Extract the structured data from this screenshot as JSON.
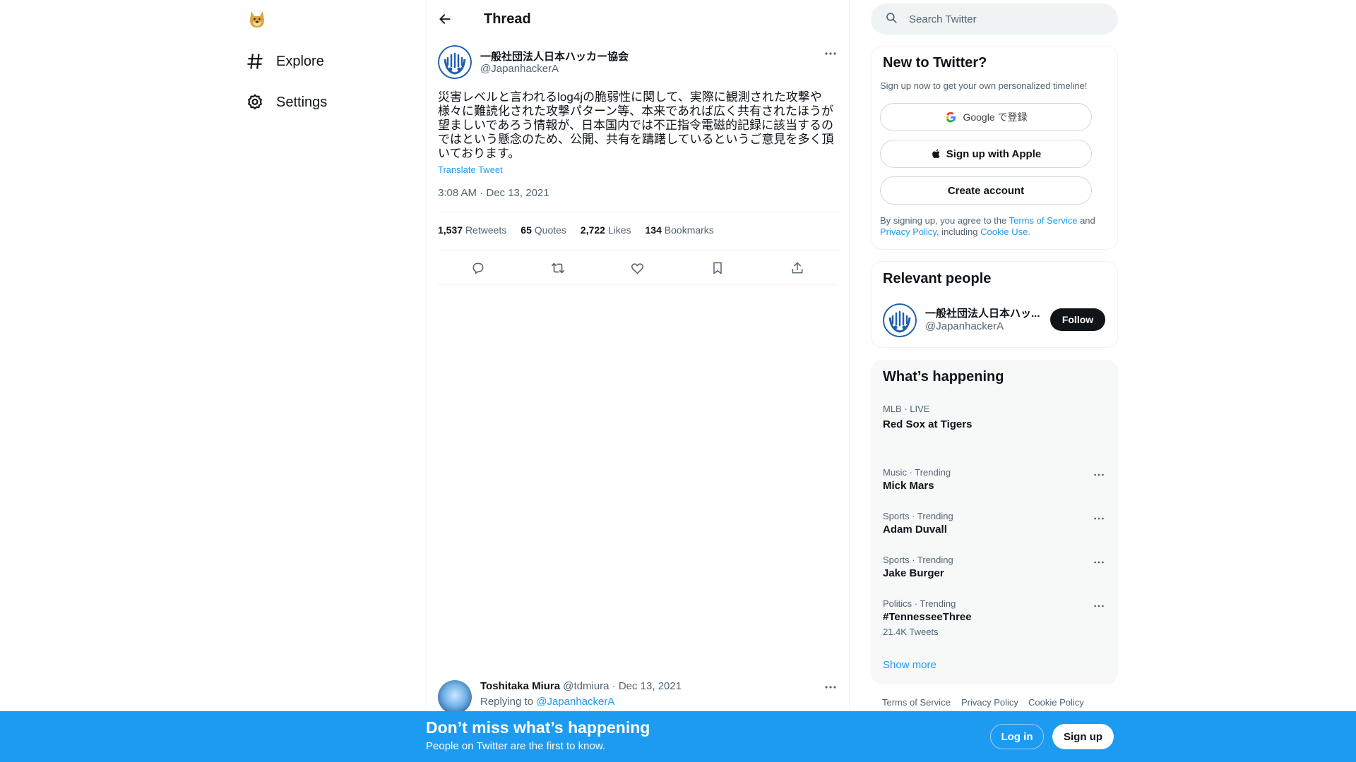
{
  "nav": {
    "logo_icon": "doge-logo-icon",
    "items": [
      {
        "label": "Explore",
        "icon": "hashtag-icon"
      },
      {
        "label": "Settings",
        "icon": "gear-icon"
      }
    ]
  },
  "header": {
    "title": "Thread"
  },
  "tweet": {
    "author_name": "一般社団法人日本ハッカー協会",
    "author_handle": "@JapanhackerA",
    "text": "災害レベルと言われるlog4jの脆弱性に関して、実際に観測された攻撃や様々に難読化された攻撃パターン等、本来であれば広く共有されたほうが望ましいであろう情報が、日本国内では不正指令電磁的記録に該当するのではという懸念のため、公開、共有を躊躇しているというご意見を多く頂いております。",
    "translate": "Translate Tweet",
    "timestamp": "3:08 AM · Dec 13, 2021",
    "stats": {
      "retweets_count": "1,537",
      "retweets_label": "Retweets",
      "quotes_count": "65",
      "quotes_label": "Quotes",
      "likes_count": "2,722",
      "likes_label": "Likes",
      "bookmarks_count": "134",
      "bookmarks_label": "Bookmarks"
    }
  },
  "reply": {
    "name": "Toshitaka Miura",
    "meta": "@tdmiura · Dec 13, 2021",
    "replying_prefix": "Replying to",
    "replying_to": "@JapanhackerA"
  },
  "search": {
    "placeholder": "Search Twitter"
  },
  "new_to_twitter": {
    "title": "New to Twitter?",
    "subtitle": "Sign up now to get your own personalized timeline!",
    "google_label": "Google で登録",
    "apple_label": "Sign up with Apple",
    "create_label": "Create account",
    "terms_prefix": "By signing up, you agree to the",
    "terms_link": "Terms of Service",
    "terms_and": "and",
    "privacy_link": "Privacy Policy",
    "including": ", including",
    "cookie_link": "Cookie Use."
  },
  "relevant_people": {
    "title": "Relevant people",
    "name": "一般社団法人日本ハッ...",
    "handle": "@JapanhackerA",
    "follow_label": "Follow"
  },
  "whats_happening": {
    "title": "What’s happening",
    "trends": [
      {
        "meta": "MLB · LIVE",
        "name": "Red Sox at Tigers",
        "count": ""
      },
      {
        "meta": "Music · Trending",
        "name": "Mick Mars",
        "count": ""
      },
      {
        "meta": "Sports · Trending",
        "name": "Adam Duvall",
        "count": ""
      },
      {
        "meta": "Sports · Trending",
        "name": "Jake Burger",
        "count": ""
      },
      {
        "meta": "Politics · Trending",
        "name": "#TennesseeThree",
        "count": "21.4K Tweets"
      }
    ],
    "show_more": "Show more"
  },
  "footer": {
    "links": [
      "Terms of Service",
      "Privacy Policy",
      "Cookie Policy"
    ]
  },
  "banner": {
    "title": "Don’t miss what’s happening",
    "subtitle": "People on Twitter are the first to know.",
    "login_label": "Log in",
    "signup_label": "Sign up"
  },
  "colors": {
    "accent": "#1d9bf0",
    "text": "#0f1419",
    "muted": "#536471",
    "border": "#eff3f4"
  }
}
